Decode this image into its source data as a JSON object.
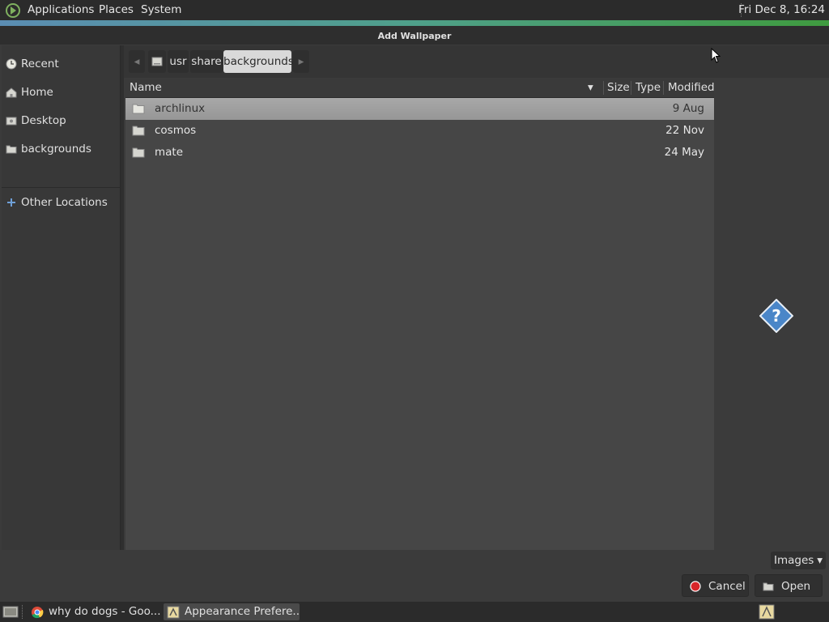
{
  "top_panel": {
    "menus": [
      "Applications",
      "Places",
      "System"
    ],
    "clock": "Fri Dec  8, 16:24"
  },
  "window": {
    "title": "Add Wallpaper"
  },
  "sidebar": {
    "items": [
      {
        "label": "Recent",
        "icon": "clock-icon"
      },
      {
        "label": "Home",
        "icon": "home-icon"
      },
      {
        "label": "Desktop",
        "icon": "desktop-icon"
      },
      {
        "label": "backgrounds",
        "icon": "folder-icon"
      },
      {
        "label": "Other Locations",
        "icon": "plus-icon"
      }
    ]
  },
  "pathbar": {
    "segments": [
      "usr",
      "share",
      "backgrounds"
    ]
  },
  "file_list": {
    "columns": [
      "Name",
      "Size",
      "Type",
      "Modified"
    ],
    "rows": [
      {
        "name": "archlinux",
        "modified": "9 Aug"
      },
      {
        "name": "cosmos",
        "modified": "22 Nov"
      },
      {
        "name": "mate",
        "modified": "24 May"
      }
    ]
  },
  "filter": {
    "selected": "Images"
  },
  "buttons": {
    "cancel": "Cancel",
    "open": "Open"
  },
  "taskbar": {
    "tasks": [
      "why do dogs - Goo...",
      "Appearance Prefere..."
    ]
  },
  "colors": {
    "accent_green": "#3f9b3f",
    "accent_blue": "#5b8db3",
    "selection": "#a0a0a0"
  }
}
